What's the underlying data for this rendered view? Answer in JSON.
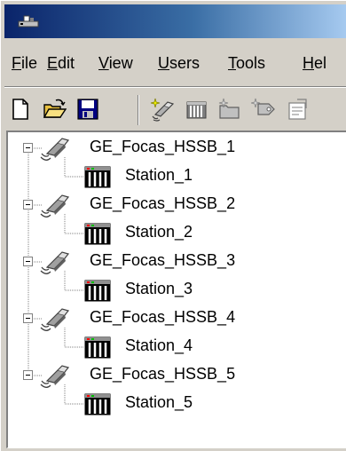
{
  "window": {
    "icon": "app-icon"
  },
  "menu": {
    "items": [
      {
        "accel": "F",
        "rest": "ile"
      },
      {
        "accel": "E",
        "rest": "dit"
      },
      {
        "accel": "V",
        "rest": "iew"
      },
      {
        "accel": "U",
        "rest": "sers"
      },
      {
        "accel": "T",
        "rest": "ools"
      },
      {
        "accel": "H",
        "rest": "el"
      }
    ]
  },
  "toolbar": {
    "buttons": [
      "new-icon",
      "open-icon",
      "save-icon",
      "new-channel-icon",
      "new-device-icon",
      "new-group-icon",
      "new-tag-icon",
      "properties-icon"
    ]
  },
  "tree": {
    "channels": [
      {
        "label": "GE_Focas_HSSB_1",
        "device": "Station_1",
        "expanded": true
      },
      {
        "label": "GE_Focas_HSSB_2",
        "device": "Station_2",
        "expanded": true
      },
      {
        "label": "GE_Focas_HSSB_3",
        "device": "Station_3",
        "expanded": true
      },
      {
        "label": "GE_Focas_HSSB_4",
        "device": "Station_4",
        "expanded": true
      },
      {
        "label": "GE_Focas_HSSB_5",
        "device": "Station_5",
        "expanded": true
      }
    ]
  }
}
